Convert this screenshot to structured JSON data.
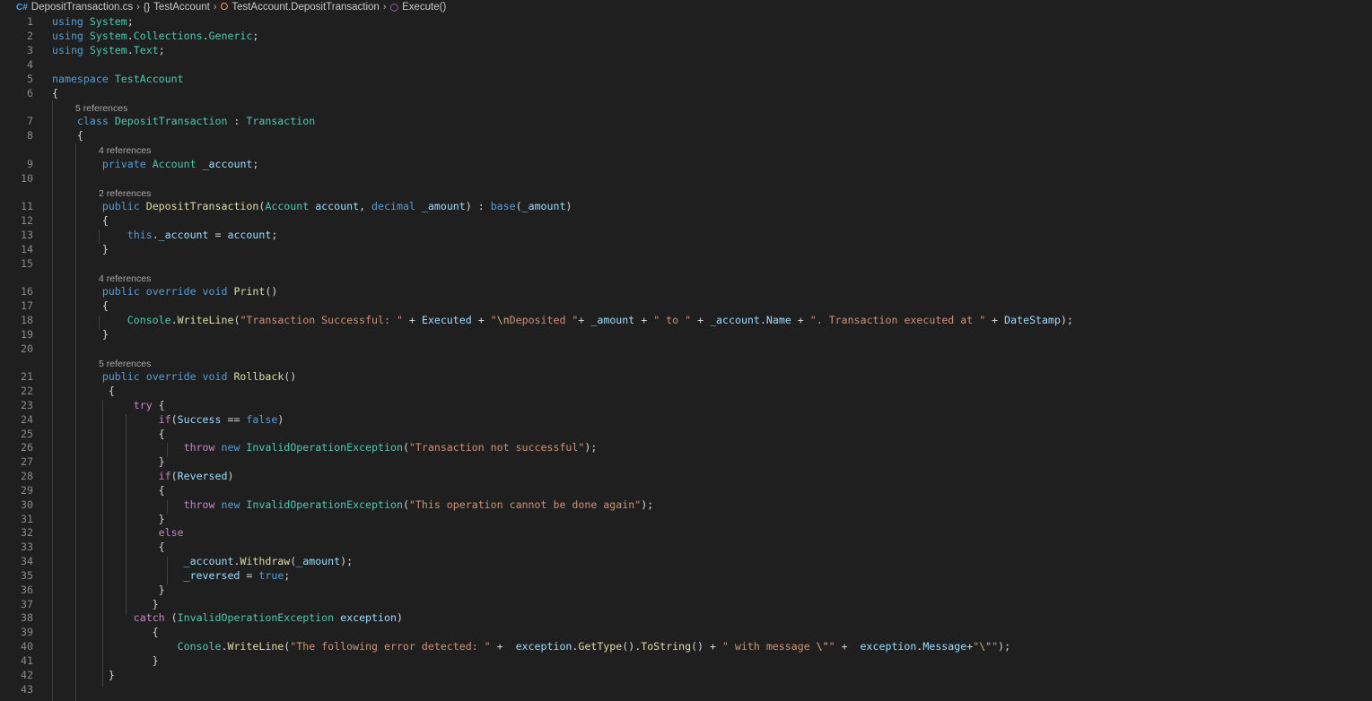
{
  "breadcrumb": {
    "file": "DepositTransaction.cs",
    "namespace": "TestAccount",
    "class": "TestAccount.DepositTransaction",
    "method": "Execute()",
    "namespace_glyph": "{}"
  },
  "codelens": {
    "class_refs": "5 references",
    "account_refs": "4 references",
    "ctor_refs": "2 references",
    "print_refs": "4 references",
    "rollback_refs": "5 references"
  },
  "line_numbers": [
    "1",
    "2",
    "3",
    "4",
    "5",
    "6",
    "7",
    "8",
    "9",
    "10",
    "11",
    "12",
    "13",
    "14",
    "15",
    "16",
    "17",
    "18",
    "19",
    "20",
    "21",
    "22",
    "23",
    "24",
    "25",
    "26",
    "27",
    "28",
    "29",
    "30",
    "31",
    "32",
    "33",
    "34",
    "35",
    "36",
    "37",
    "38",
    "39",
    "40",
    "41",
    "42",
    "43"
  ],
  "code": {
    "l1": [
      [
        "using",
        "kw"
      ],
      [
        " ",
        ""
      ],
      [
        "System",
        "ns"
      ],
      [
        ";",
        ""
      ]
    ],
    "l2": [
      [
        "using",
        "kw"
      ],
      [
        " ",
        ""
      ],
      [
        "System",
        "ns"
      ],
      [
        ".",
        ""
      ],
      [
        "Collections",
        "ns"
      ],
      [
        ".",
        ""
      ],
      [
        "Generic",
        "ns"
      ],
      [
        ";",
        ""
      ]
    ],
    "l3": [
      [
        "using",
        "kw"
      ],
      [
        " ",
        ""
      ],
      [
        "System",
        "ns"
      ],
      [
        ".",
        ""
      ],
      [
        "Text",
        "ns"
      ],
      [
        ";",
        ""
      ]
    ],
    "l4": [],
    "l5": [
      [
        "namespace",
        "kw"
      ],
      [
        " ",
        ""
      ],
      [
        "TestAccount",
        "ns"
      ]
    ],
    "l6": [
      [
        "{",
        ""
      ]
    ],
    "l7": [
      [
        "    ",
        ""
      ],
      [
        "class",
        "kw"
      ],
      [
        " ",
        ""
      ],
      [
        "DepositTransaction",
        "typ"
      ],
      [
        " : ",
        ""
      ],
      [
        "Transaction",
        "typ"
      ]
    ],
    "l8": [
      [
        "    {",
        ""
      ]
    ],
    "l9": [
      [
        "        ",
        ""
      ],
      [
        "private",
        "kw"
      ],
      [
        " ",
        ""
      ],
      [
        "Account",
        "typ"
      ],
      [
        " ",
        ""
      ],
      [
        "_account",
        "var"
      ],
      [
        ";",
        ""
      ]
    ],
    "l10": [],
    "l11": [
      [
        "        ",
        ""
      ],
      [
        "public",
        "kw"
      ],
      [
        " ",
        ""
      ],
      [
        "DepositTransaction",
        "fn"
      ],
      [
        "(",
        ""
      ],
      [
        "Account",
        "typ"
      ],
      [
        " ",
        ""
      ],
      [
        "account",
        "var"
      ],
      [
        ", ",
        ""
      ],
      [
        "decimal",
        "kw"
      ],
      [
        " ",
        ""
      ],
      [
        "_amount",
        "var"
      ],
      [
        ") : ",
        ""
      ],
      [
        "base",
        "kw"
      ],
      [
        "(",
        ""
      ],
      [
        "_amount",
        "var"
      ],
      [
        ")",
        ""
      ]
    ],
    "l12": [
      [
        "        {",
        ""
      ]
    ],
    "l13": [
      [
        "            ",
        ""
      ],
      [
        "this",
        "kw"
      ],
      [
        ".",
        ""
      ],
      [
        "_account",
        "var"
      ],
      [
        " = ",
        ""
      ],
      [
        "account",
        "var"
      ],
      [
        ";",
        ""
      ]
    ],
    "l14": [
      [
        "        }",
        ""
      ]
    ],
    "l15": [],
    "l16": [
      [
        "        ",
        ""
      ],
      [
        "public",
        "kw"
      ],
      [
        " ",
        ""
      ],
      [
        "override",
        "kw"
      ],
      [
        " ",
        ""
      ],
      [
        "void",
        "kw"
      ],
      [
        " ",
        ""
      ],
      [
        "Print",
        "fn"
      ],
      [
        "()",
        ""
      ]
    ],
    "l17": [
      [
        "        {",
        ""
      ]
    ],
    "l18": [
      [
        "            ",
        ""
      ],
      [
        "Console",
        "typ"
      ],
      [
        ".",
        ""
      ],
      [
        "WriteLine",
        "fn"
      ],
      [
        "(",
        ""
      ],
      [
        "\"Transaction Successful: \"",
        "str"
      ],
      [
        " + ",
        ""
      ],
      [
        "Executed",
        "var"
      ],
      [
        " + ",
        ""
      ],
      [
        "\"",
        "str"
      ],
      [
        "\\n",
        "esc"
      ],
      [
        "Deposited \"",
        "str"
      ],
      [
        "+ ",
        ""
      ],
      [
        "_amount",
        "var"
      ],
      [
        " + ",
        ""
      ],
      [
        "\" to \"",
        "str"
      ],
      [
        " + ",
        ""
      ],
      [
        "_account",
        "var"
      ],
      [
        ".",
        ""
      ],
      [
        "Name",
        "var"
      ],
      [
        " + ",
        ""
      ],
      [
        "\". Transaction executed at \"",
        "str"
      ],
      [
        " + ",
        ""
      ],
      [
        "DateStamp",
        "var"
      ],
      [
        ");",
        ""
      ]
    ],
    "l19": [
      [
        "        }",
        ""
      ]
    ],
    "l20": [],
    "l21": [
      [
        "        ",
        ""
      ],
      [
        "public",
        "kw"
      ],
      [
        " ",
        ""
      ],
      [
        "override",
        "kw"
      ],
      [
        " ",
        ""
      ],
      [
        "void",
        "kw"
      ],
      [
        " ",
        ""
      ],
      [
        "Rollback",
        "fn"
      ],
      [
        "()",
        ""
      ]
    ],
    "l22": [
      [
        "         {",
        ""
      ]
    ],
    "l23": [
      [
        "             ",
        ""
      ],
      [
        "try",
        "ctrl"
      ],
      [
        " {",
        ""
      ]
    ],
    "l24": [
      [
        "                 ",
        ""
      ],
      [
        "if",
        "ctrl"
      ],
      [
        "(",
        ""
      ],
      [
        "Success",
        "var"
      ],
      [
        " == ",
        ""
      ],
      [
        "false",
        "kw"
      ],
      [
        ")",
        ""
      ]
    ],
    "l25": [
      [
        "                 {",
        ""
      ]
    ],
    "l26": [
      [
        "                     ",
        ""
      ],
      [
        "throw",
        "ctrl"
      ],
      [
        " ",
        ""
      ],
      [
        "new",
        "kw"
      ],
      [
        " ",
        ""
      ],
      [
        "InvalidOperationException",
        "typ"
      ],
      [
        "(",
        ""
      ],
      [
        "\"Transaction not successful\"",
        "str"
      ],
      [
        ");",
        ""
      ]
    ],
    "l27": [
      [
        "                 }",
        ""
      ]
    ],
    "l28": [
      [
        "                 ",
        ""
      ],
      [
        "if",
        "ctrl"
      ],
      [
        "(",
        ""
      ],
      [
        "Reversed",
        "var"
      ],
      [
        ")",
        ""
      ]
    ],
    "l29": [
      [
        "                 {",
        ""
      ]
    ],
    "l30": [
      [
        "                     ",
        ""
      ],
      [
        "throw",
        "ctrl"
      ],
      [
        " ",
        ""
      ],
      [
        "new",
        "kw"
      ],
      [
        " ",
        ""
      ],
      [
        "InvalidOperationException",
        "typ"
      ],
      [
        "(",
        ""
      ],
      [
        "\"This operation cannot be done again\"",
        "str"
      ],
      [
        ");",
        ""
      ]
    ],
    "l31": [
      [
        "                 }",
        ""
      ]
    ],
    "l32": [
      [
        "                 ",
        ""
      ],
      [
        "else",
        "ctrl"
      ]
    ],
    "l33": [
      [
        "                 {",
        ""
      ]
    ],
    "l34": [
      [
        "                     ",
        ""
      ],
      [
        "_account",
        "var"
      ],
      [
        ".",
        ""
      ],
      [
        "Withdraw",
        "fn"
      ],
      [
        "(",
        ""
      ],
      [
        "_amount",
        "var"
      ],
      [
        ");",
        ""
      ]
    ],
    "l35": [
      [
        "                     ",
        ""
      ],
      [
        "_reversed",
        "var"
      ],
      [
        " = ",
        ""
      ],
      [
        "true",
        "kw"
      ],
      [
        ";",
        ""
      ]
    ],
    "l36": [
      [
        "                 }",
        ""
      ]
    ],
    "l37": [
      [
        "                }",
        ""
      ]
    ],
    "l38": [
      [
        "             ",
        ""
      ],
      [
        "catch",
        "ctrl"
      ],
      [
        " (",
        ""
      ],
      [
        "InvalidOperationException",
        "typ"
      ],
      [
        " ",
        ""
      ],
      [
        "exception",
        "var"
      ],
      [
        ")",
        ""
      ]
    ],
    "l39": [
      [
        "                {",
        ""
      ]
    ],
    "l40": [
      [
        "                    ",
        ""
      ],
      [
        "Console",
        "typ"
      ],
      [
        ".",
        ""
      ],
      [
        "WriteLine",
        "fn"
      ],
      [
        "(",
        ""
      ],
      [
        "\"The following error detected: \"",
        "str"
      ],
      [
        " +  ",
        ""
      ],
      [
        "exception",
        "var"
      ],
      [
        ".",
        ""
      ],
      [
        "GetType",
        "fn"
      ],
      [
        "().",
        ""
      ],
      [
        "ToString",
        "fn"
      ],
      [
        "() + ",
        ""
      ],
      [
        "\" with message ",
        "str"
      ],
      [
        "\\\"",
        "esc"
      ],
      [
        "\"",
        "str"
      ],
      [
        " +  ",
        ""
      ],
      [
        "exception",
        "var"
      ],
      [
        ".",
        ""
      ],
      [
        "Message",
        "var"
      ],
      [
        "+",
        ""
      ],
      [
        "\"",
        "str"
      ],
      [
        "\\\"",
        "esc"
      ],
      [
        "\"",
        "str"
      ],
      [
        ");",
        ""
      ]
    ],
    "l41": [
      [
        "                }",
        ""
      ]
    ],
    "l42": [
      [
        "         }",
        ""
      ]
    ],
    "l43": []
  },
  "colors": {
    "background": "#1f1f1f",
    "keyword": "#569cd6",
    "control": "#c586c0",
    "type": "#4ec9b0",
    "function": "#dcdcaa",
    "string": "#ce9178",
    "variable": "#9cdcfe"
  }
}
